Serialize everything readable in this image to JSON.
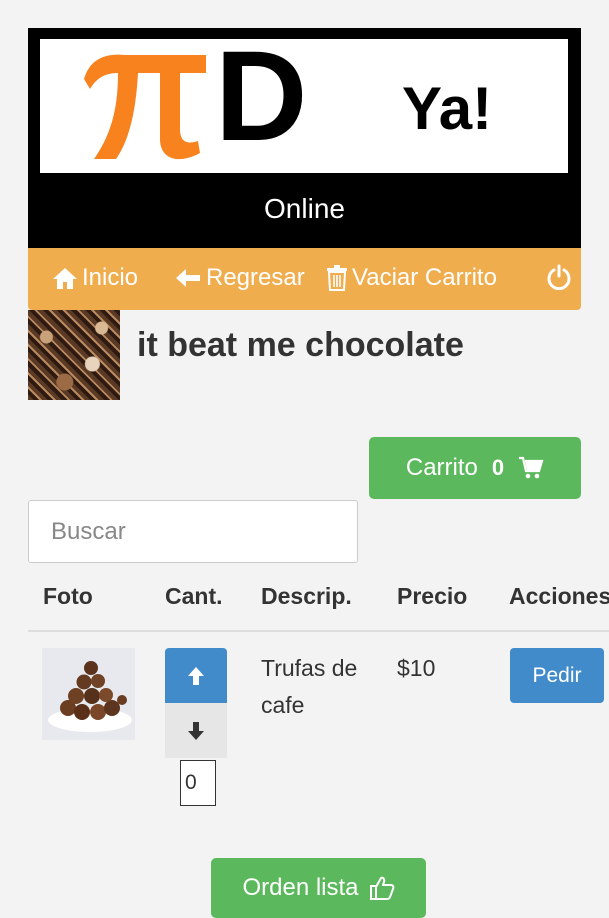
{
  "brand": {
    "logo_text_d": "D",
    "logo_text_ya": "Ya!",
    "subtitle": "Online",
    "pi_color": "#f7821e"
  },
  "nav": {
    "home_label": "Inicio",
    "back_label": "Regresar",
    "empty_cart_label": "Vaciar Carrito"
  },
  "store": {
    "name": "it beat me chocolate"
  },
  "cart": {
    "label": "Carrito",
    "count": "0"
  },
  "search": {
    "placeholder": "Buscar",
    "value": ""
  },
  "table": {
    "columns": [
      "Foto",
      "Cant.",
      "Descrip.",
      "Precio",
      "Acciones"
    ],
    "rows": [
      {
        "description": "Trufas de cafe",
        "price": "$10",
        "quantity": "0",
        "action_label": "Pedir"
      }
    ]
  },
  "footer": {
    "order_label": "Orden lista"
  },
  "colors": {
    "nav_orange": "#f0ad4e",
    "success_green": "#5cb85c",
    "primary_blue": "#428bca"
  }
}
